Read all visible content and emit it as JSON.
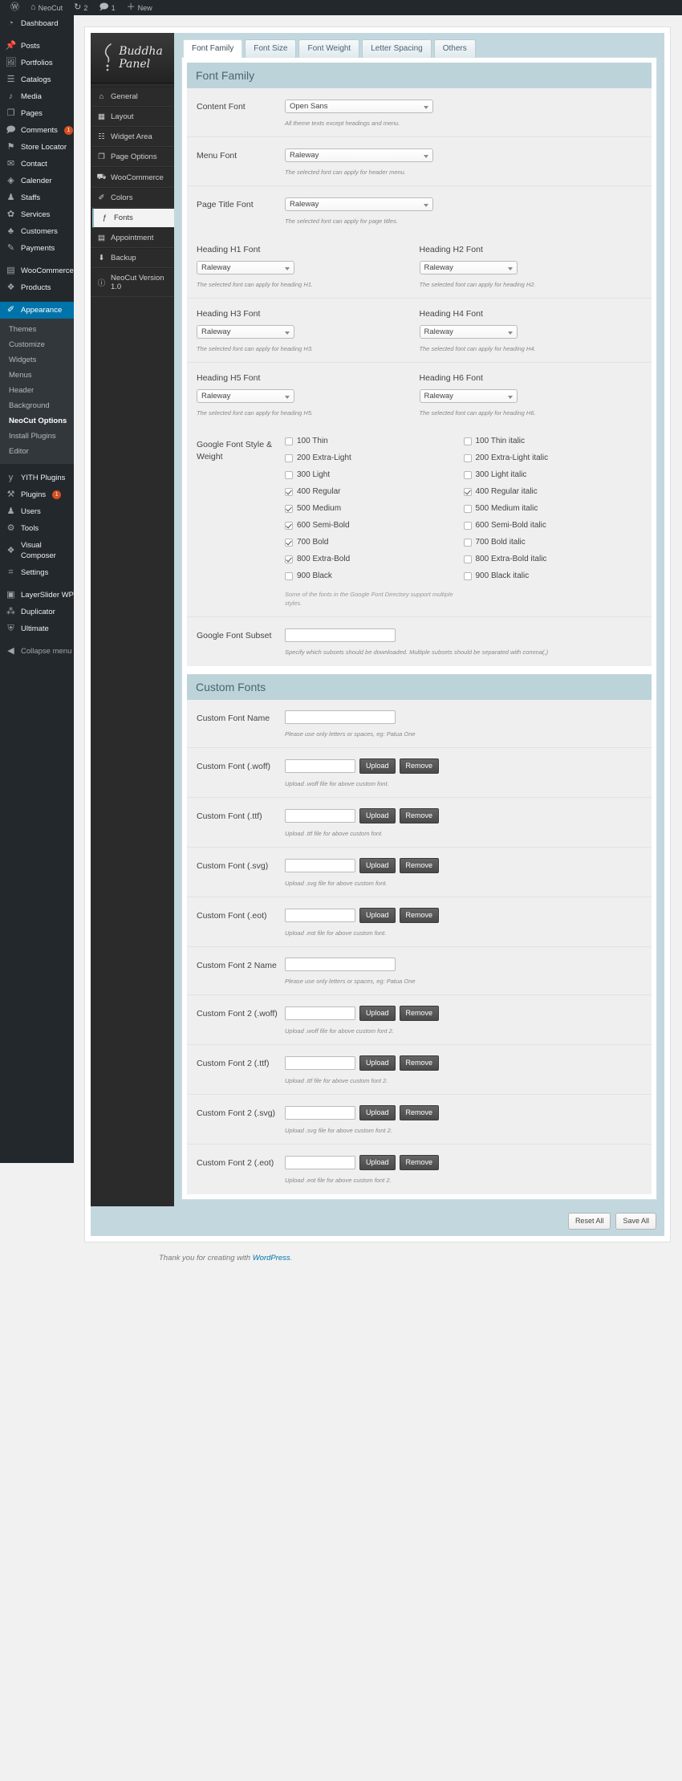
{
  "adminbar": {
    "items": [
      {
        "icon": "wordpress-logo-icon",
        "label": ""
      },
      {
        "icon": "home-icon",
        "label": "NeoCut"
      },
      {
        "icon": "update-icon",
        "label": "2"
      },
      {
        "icon": "comment-icon",
        "label": "1"
      },
      {
        "icon": "plus-icon",
        "label": "New"
      }
    ]
  },
  "adminmenu": {
    "items": [
      {
        "label": "Dashboard",
        "icon": "dashboard-icon"
      },
      {
        "label": "Posts",
        "icon": "pin-icon",
        "sep": true
      },
      {
        "label": "Portfolios",
        "icon": "images-icon"
      },
      {
        "label": "Catalogs",
        "icon": "list-icon"
      },
      {
        "label": "Media",
        "icon": "media-icon"
      },
      {
        "label": "Pages",
        "icon": "pages-icon"
      },
      {
        "label": "Comments",
        "icon": "comment-icon",
        "badge": "1"
      },
      {
        "label": "Store Locator",
        "icon": "map-pin-icon"
      },
      {
        "label": "Contact",
        "icon": "envelope-icon"
      },
      {
        "label": "Calender",
        "icon": "calendar-icon"
      },
      {
        "label": "Staffs",
        "icon": "user-icon"
      },
      {
        "label": "Services",
        "icon": "award-icon"
      },
      {
        "label": "Customers",
        "icon": "group-icon"
      },
      {
        "label": "Payments",
        "icon": "edit-icon"
      },
      {
        "label": "WooCommerce",
        "icon": "woo-icon",
        "sep": true
      },
      {
        "label": "Products",
        "icon": "box-icon"
      },
      {
        "label": "Appearance",
        "icon": "brush-icon",
        "current": true,
        "sep": true
      },
      {
        "label": "YITH Plugins",
        "icon": "yith-icon",
        "sep": true
      },
      {
        "label": "Plugins",
        "icon": "plug-icon",
        "badge": "1"
      },
      {
        "label": "Users",
        "icon": "users-icon"
      },
      {
        "label": "Tools",
        "icon": "wrench-icon"
      },
      {
        "label": "Visual Composer",
        "icon": "vc-icon"
      },
      {
        "label": "Settings",
        "icon": "settings-icon"
      },
      {
        "label": "LayerSlider WP",
        "icon": "slider-icon",
        "sep": true
      },
      {
        "label": "Duplicator",
        "icon": "share-icon"
      },
      {
        "label": "Ultimate",
        "icon": "shield-icon"
      },
      {
        "label": "Collapse menu",
        "icon": "collapse-icon",
        "collapse": true
      }
    ],
    "appearance_submenu": [
      {
        "label": "Themes"
      },
      {
        "label": "Customize"
      },
      {
        "label": "Widgets"
      },
      {
        "label": "Menus"
      },
      {
        "label": "Header"
      },
      {
        "label": "Background"
      },
      {
        "label": "NeoCut Options",
        "current": true
      },
      {
        "label": "Install Plugins"
      },
      {
        "label": "Editor"
      }
    ]
  },
  "panel": {
    "brand": {
      "line1": "Buddha",
      "line2": "Panel"
    },
    "nav": [
      {
        "label": "General",
        "icon": "home-icon"
      },
      {
        "label": "Layout",
        "icon": "layout-icon"
      },
      {
        "label": "Widget Area",
        "icon": "widget-icon"
      },
      {
        "label": "Page Options",
        "icon": "pages-icon"
      },
      {
        "label": "WooCommerce",
        "icon": "cart-icon"
      },
      {
        "label": "Colors",
        "icon": "brush-icon"
      },
      {
        "label": "Fonts",
        "icon": "font-icon",
        "active": true
      },
      {
        "label": "Appointment",
        "icon": "clipboard-icon"
      },
      {
        "label": "Backup",
        "icon": "backup-icon"
      },
      {
        "label": "NeoCut Version 1.0",
        "icon": "info-icon"
      }
    ],
    "tabs": [
      {
        "label": "Font Family",
        "active": true
      },
      {
        "label": "Font Size"
      },
      {
        "label": "Font Weight"
      },
      {
        "label": "Letter Spacing"
      },
      {
        "label": "Others"
      }
    ],
    "section_font_family": {
      "title": "Font Family",
      "fields": [
        {
          "label": "Content Font",
          "value": "Open Sans",
          "desc": "All theme texts except headings and menu."
        },
        {
          "label": "Menu Font",
          "value": "Raleway",
          "desc": "The selected font can apply for header menu."
        },
        {
          "label": "Page Title Font",
          "value": "Raleway",
          "desc": "The selected font can apply for page titles."
        }
      ],
      "heading_rows": [
        [
          {
            "label": "Heading H1 Font",
            "value": "Raleway",
            "desc": "The selected font can apply for heading H1."
          },
          {
            "label": "Heading H2 Font",
            "value": "Raleway",
            "desc": "The selected font can apply for heading H2."
          }
        ],
        [
          {
            "label": "Heading H3 Font",
            "value": "Raleway",
            "desc": "The selected font can apply for heading H3."
          },
          {
            "label": "Heading H4 Font",
            "value": "Raleway",
            "desc": "The selected font can apply for heading H4."
          }
        ],
        [
          {
            "label": "Heading H5 Font",
            "value": "Raleway",
            "desc": "The selected font can apply for heading H5."
          },
          {
            "label": "Heading H6 Font",
            "value": "Raleway",
            "desc": "The selected font can apply for heading H6."
          }
        ]
      ],
      "weights": {
        "label": "Google Font Style & Weight",
        "note": "Some of the fonts in the Google Font Directory support multiple styles.",
        "left": [
          {
            "label": "100 Thin",
            "checked": false
          },
          {
            "label": "200 Extra-Light",
            "checked": false
          },
          {
            "label": "300 Light",
            "checked": false
          },
          {
            "label": "400 Regular",
            "checked": true
          },
          {
            "label": "500 Medium",
            "checked": true
          },
          {
            "label": "600 Semi-Bold",
            "checked": true
          },
          {
            "label": "700 Bold",
            "checked": true
          },
          {
            "label": "800 Extra-Bold",
            "checked": true
          },
          {
            "label": "900 Black",
            "checked": false
          }
        ],
        "right": [
          {
            "label": "100 Thin italic",
            "checked": false
          },
          {
            "label": "200 Extra-Light italic",
            "checked": false
          },
          {
            "label": "300 Light italic",
            "checked": false
          },
          {
            "label": "400 Regular italic",
            "checked": true
          },
          {
            "label": "500 Medium italic",
            "checked": false
          },
          {
            "label": "600 Semi-Bold italic",
            "checked": false
          },
          {
            "label": "700 Bold italic",
            "checked": false
          },
          {
            "label": "800 Extra-Bold italic",
            "checked": false
          },
          {
            "label": "900 Black italic",
            "checked": false
          }
        ]
      },
      "subset": {
        "label": "Google Font Subset",
        "value": "",
        "desc": "Specify which subsets should be downloaded. Multiple subsets should be separated with comma(,)"
      }
    },
    "section_custom_fonts": {
      "title": "Custom Fonts",
      "rows": [
        {
          "label": "Custom Font Name",
          "type": "text",
          "value": "",
          "desc": "Please use only letters or spaces, eg: Patua One"
        },
        {
          "label": "Custom Font (.woff)",
          "type": "upload",
          "value": "",
          "desc": "Upload .woff file for above custom font.",
          "upload": "Upload",
          "remove": "Remove"
        },
        {
          "label": "Custom Font (.ttf)",
          "type": "upload",
          "value": "",
          "desc": "Upload .ttf file for above custom font.",
          "upload": "Upload",
          "remove": "Remove"
        },
        {
          "label": "Custom Font (.svg)",
          "type": "upload",
          "value": "",
          "desc": "Upload .svg file for above custom font.",
          "upload": "Upload",
          "remove": "Remove"
        },
        {
          "label": "Custom Font (.eot)",
          "type": "upload",
          "value": "",
          "desc": "Upload .eot file for above custom font.",
          "upload": "Upload",
          "remove": "Remove"
        },
        {
          "label": "Custom Font 2 Name",
          "type": "text",
          "value": "",
          "desc": "Please use only letters or spaces, eg: Patua One"
        },
        {
          "label": "Custom Font 2 (.woff)",
          "type": "upload",
          "value": "",
          "desc": "Upload .woff file for above custom font 2.",
          "upload": "Upload",
          "remove": "Remove"
        },
        {
          "label": "Custom Font 2 (.ttf)",
          "type": "upload",
          "value": "",
          "desc": "Upload .ttf file for above custom font 2.",
          "upload": "Upload",
          "remove": "Remove"
        },
        {
          "label": "Custom Font 2 (.svg)",
          "type": "upload",
          "value": "",
          "desc": "Upload .svg file for above custom font 2.",
          "upload": "Upload",
          "remove": "Remove"
        },
        {
          "label": "Custom Font 2 (.eot)",
          "type": "upload",
          "value": "",
          "desc": "Upload .eot file for above custom font 2.",
          "upload": "Upload",
          "remove": "Remove"
        }
      ]
    },
    "footer": {
      "reset": "Reset All",
      "save": "Save All"
    }
  },
  "wpfooter": {
    "thanks": "Thank you for creating with ",
    "link": "WordPress",
    "suffix": "."
  },
  "colors": {
    "admin_dark": "#23282d",
    "admin_submenu": "#32373c",
    "accent_blue": "#0073aa",
    "badge": "#d54e21",
    "panel_header": "#bdd3da",
    "panel_frame": "#c3d7de"
  }
}
